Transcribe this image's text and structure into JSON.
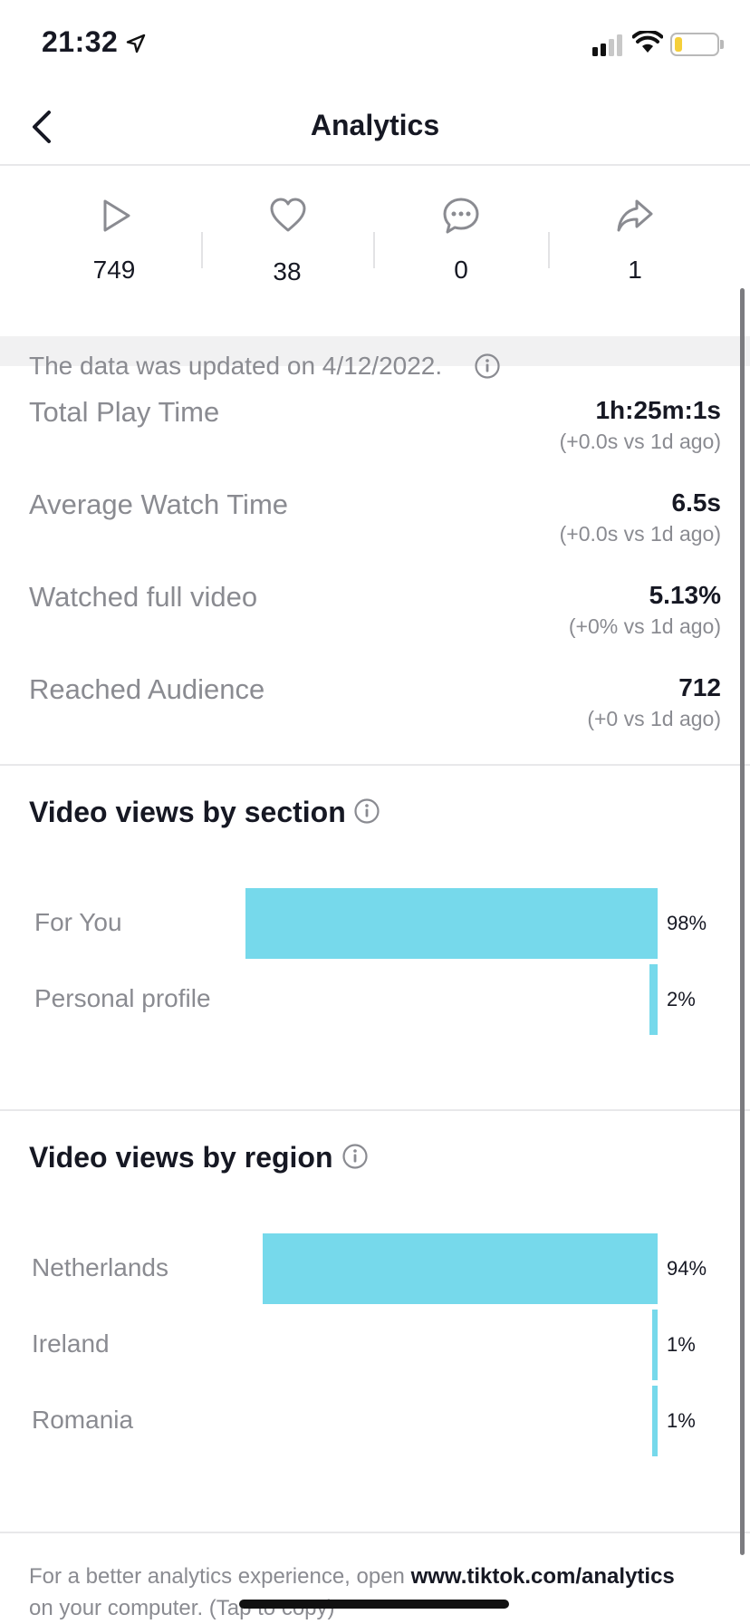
{
  "status_bar": {
    "time": "21:32"
  },
  "header": {
    "title": "Analytics"
  },
  "stats": [
    {
      "icon": "play-icon",
      "value": "749"
    },
    {
      "icon": "heart-icon",
      "value": "38"
    },
    {
      "icon": "comment-icon",
      "value": "0"
    },
    {
      "icon": "share-icon",
      "value": "1"
    }
  ],
  "update_notice": "The data was updated on 4/12/2022.",
  "metrics": [
    {
      "label": "Total Play Time",
      "value": "1h:25m:1s",
      "delta": "(+0.0s vs 1d ago)"
    },
    {
      "label": "Average Watch Time",
      "value": "6.5s",
      "delta": "(+0.0s vs 1d ago)"
    },
    {
      "label": "Watched full video",
      "value": "5.13%",
      "delta": "(+0% vs 1d ago)"
    },
    {
      "label": "Reached Audience",
      "value": "712",
      "delta": "(+0 vs 1d ago)"
    }
  ],
  "section_chart": {
    "title": "Video views by section",
    "rows": [
      {
        "label": "For You",
        "pct_label": "98%",
        "pct": 98
      },
      {
        "label": "Personal profile",
        "pct_label": "2%",
        "pct": 2
      }
    ]
  },
  "region_chart": {
    "title": "Video views by region",
    "rows": [
      {
        "label": "Netherlands",
        "pct_label": "94%",
        "pct": 94
      },
      {
        "label": "Ireland",
        "pct_label": "1%",
        "pct": 1
      },
      {
        "label": "Romania",
        "pct_label": "1%",
        "pct": 1
      }
    ]
  },
  "footer": {
    "text_before": "For a better analytics experience, open ",
    "link": "www.tiktok.com/analytics",
    "text_after": "on your computer. (Tap to copy)"
  },
  "colors": {
    "bar": "#76d9eb",
    "text": "#161823",
    "muted": "#8a8b91"
  }
}
